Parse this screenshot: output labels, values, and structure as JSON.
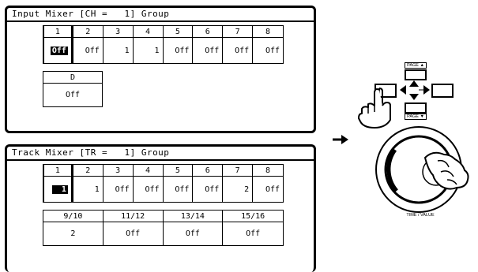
{
  "input_mixer": {
    "title": "Input Mixer [CH =   1] Group",
    "channels": [
      {
        "label": "1",
        "value": "Off",
        "selected": true
      },
      {
        "label": "2",
        "value": "Off"
      },
      {
        "label": "3",
        "value": "1"
      },
      {
        "label": "4",
        "value": "1"
      },
      {
        "label": "5",
        "value": "Off"
      },
      {
        "label": "6",
        "value": "Off"
      },
      {
        "label": "7",
        "value": "Off"
      },
      {
        "label": "8",
        "value": "Off"
      }
    ],
    "digital": {
      "label": "D",
      "value": "Off"
    }
  },
  "track_mixer": {
    "title": "Track Mixer [TR =   1] Group",
    "tracks": [
      {
        "label": "1",
        "value": "1",
        "selected": true
      },
      {
        "label": "2",
        "value": "1"
      },
      {
        "label": "3",
        "value": "Off"
      },
      {
        "label": "4",
        "value": "Off"
      },
      {
        "label": "5",
        "value": "Off"
      },
      {
        "label": "6",
        "value": "Off"
      },
      {
        "label": "7",
        "value": "2"
      },
      {
        "label": "8",
        "value": "Off"
      }
    ],
    "pairs": [
      {
        "label": "9/10",
        "value": "2"
      },
      {
        "label": "11/12",
        "value": "Off"
      },
      {
        "label": "13/14",
        "value": "Off"
      },
      {
        "label": "15/16",
        "value": "Off"
      }
    ]
  },
  "controls": {
    "page_up_label": "PAGE ▲",
    "page_down_label": "PAGE ▼",
    "dial_label": "TIME / VALUE"
  }
}
